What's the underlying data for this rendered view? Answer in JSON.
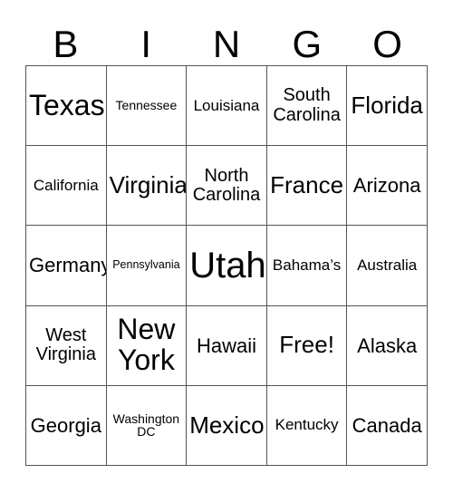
{
  "card": {
    "header_letters": [
      "B",
      "I",
      "N",
      "G",
      "O"
    ],
    "rows": [
      [
        {
          "label": "Texas",
          "size": "fs-xl"
        },
        {
          "label": "Tennessee",
          "size": "fs-xxs"
        },
        {
          "label": "Louisiana",
          "size": "fs-xs"
        },
        {
          "label": "South\nCarolina",
          "size": "fs-sm"
        },
        {
          "label": "Florida",
          "size": "fs-lg"
        }
      ],
      [
        {
          "label": "California",
          "size": "fs-xs"
        },
        {
          "label": "Virginia",
          "size": "fs-lg"
        },
        {
          "label": "North\nCarolina",
          "size": "fs-sm"
        },
        {
          "label": "France",
          "size": "fs-lg"
        },
        {
          "label": "Arizona",
          "size": "fs-md"
        }
      ],
      [
        {
          "label": "Germany",
          "size": "fs-md"
        },
        {
          "label": "Pennsylvania",
          "size": "fs-tiny"
        },
        {
          "label": "Utah",
          "size": "fs-xxl"
        },
        {
          "label": "Bahama’s",
          "size": "fs-xs"
        },
        {
          "label": "Australia",
          "size": "fs-xs"
        }
      ],
      [
        {
          "label": "West\nVirginia",
          "size": "fs-sm"
        },
        {
          "label": "New\nYork",
          "size": "fs-xl"
        },
        {
          "label": "Hawaii",
          "size": "fs-md"
        },
        {
          "label": "Free!",
          "size": "fs-lg"
        },
        {
          "label": "Alaska",
          "size": "fs-md"
        }
      ],
      [
        {
          "label": "Georgia",
          "size": "fs-md"
        },
        {
          "label": "Washington\nDC",
          "size": "fs-xxs"
        },
        {
          "label": "Mexico",
          "size": "fs-lg"
        },
        {
          "label": "Kentucky",
          "size": "fs-xs"
        },
        {
          "label": "Canada",
          "size": "fs-md"
        }
      ]
    ]
  },
  "colors": {
    "background": "#ffffff",
    "text": "#000000",
    "grid_line": "#555555"
  }
}
